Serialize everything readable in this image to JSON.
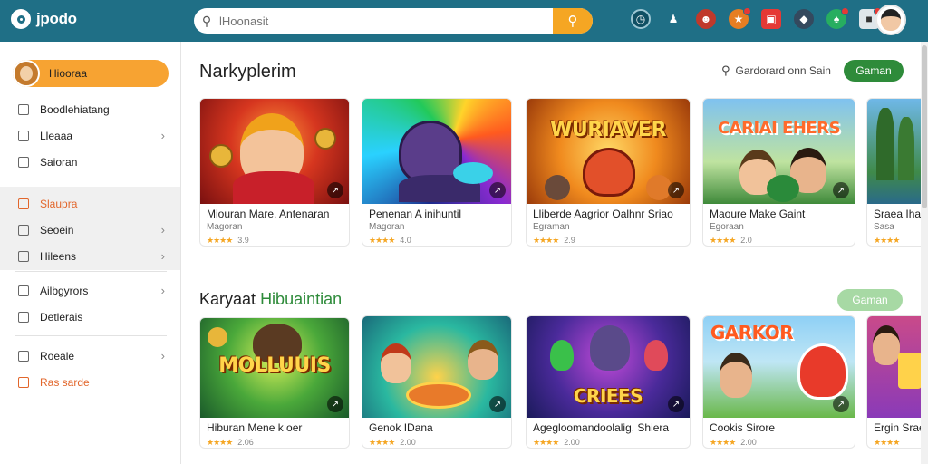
{
  "app": {
    "logo_text": "jpodo"
  },
  "search": {
    "placeholder": "lHoonasit"
  },
  "sidebar": {
    "profile_name": "Hiooraa",
    "group1": [
      {
        "label": "Boodlehiatang",
        "chevron": false
      },
      {
        "label": "Lleaaa",
        "chevron": true
      },
      {
        "label": "Saioran",
        "chevron": false
      }
    ],
    "group2": [
      {
        "label": "Slaupra",
        "chevron": false,
        "accent": true
      },
      {
        "label": "Seoein",
        "chevron": true
      },
      {
        "label": "Hileens",
        "chevron": true
      }
    ],
    "group3": [
      {
        "label": "Ailbgyrors",
        "chevron": true
      },
      {
        "label": "Detlerais",
        "chevron": false
      }
    ],
    "group4": [
      {
        "label": "Roeale",
        "chevron": true
      },
      {
        "label": "Ras sarde",
        "chevron": false,
        "accent": true
      }
    ]
  },
  "section1": {
    "title": "Narkyplerim",
    "filter_label": "Gardorard onn Sain",
    "button_label": "Gaman",
    "cards": [
      {
        "title": "Miouran Mare, Antenaran",
        "subtitle": "Magoran",
        "rating": "3.9",
        "stars": "★★★★",
        "thumb_text": ""
      },
      {
        "title": "Penenan A inihuntil",
        "subtitle": "Magoran",
        "rating": "4.0",
        "stars": "★★★★",
        "thumb_text": ""
      },
      {
        "title": "Lliberde Aagrior Oalhnr Sriao",
        "subtitle": "Egraman",
        "rating": "2.9",
        "stars": "★★★★",
        "thumb_text": "WURIAVER"
      },
      {
        "title": "Maoure Make Gaint",
        "subtitle": "Egoraan",
        "rating": "2.0",
        "stars": "★★★★",
        "thumb_text": "CARIAI EHERS"
      },
      {
        "title": "Sraea Ihai",
        "subtitle": "Sasa",
        "rating": "",
        "stars": "★★★★",
        "thumb_text": ""
      }
    ]
  },
  "section2": {
    "title_main": "Karyaat",
    "title_highlight": "Hibuaintian",
    "button_label": "Gaman",
    "cards": [
      {
        "title": "Hiburan Mene k oer",
        "rating": "2.06",
        "stars": "★★★★",
        "thumb_text": "MOLLUUIS"
      },
      {
        "title": "Genok IDana",
        "rating": "2.00",
        "stars": "★★★★",
        "thumb_text": ""
      },
      {
        "title": "Agegloomandoolalig, Shiera",
        "rating": "2.00",
        "stars": "★★★★",
        "thumb_text": "CRIEES"
      },
      {
        "title": "Cookis Sirore",
        "rating": "2.00",
        "stars": "★★★★",
        "thumb_text": "GARKOR"
      },
      {
        "title": "Ergin Sraea",
        "rating": "",
        "stars": "★★★★",
        "thumb_text": ""
      }
    ]
  },
  "colors": {
    "topbar": "#1f6f86",
    "accent_orange": "#f5a623",
    "accent_green": "#2e8b3a"
  }
}
